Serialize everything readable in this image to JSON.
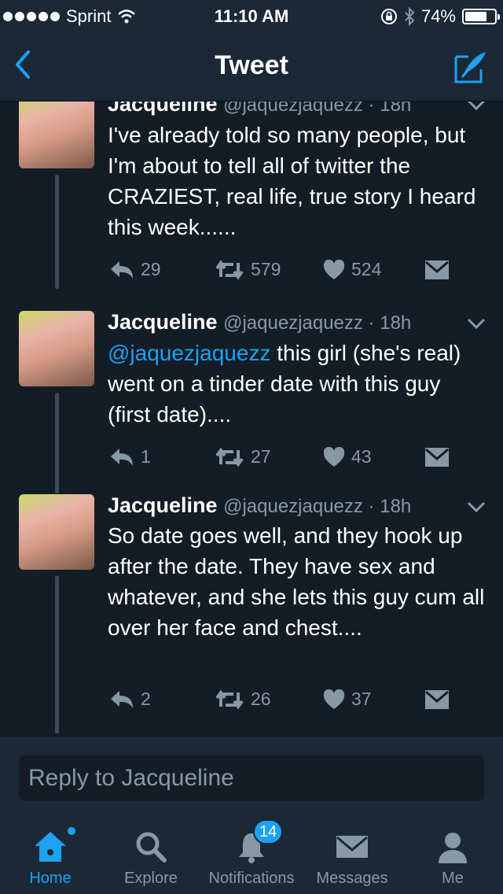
{
  "status": {
    "carrier": "Sprint",
    "time": "11:10 AM",
    "battery": "74%",
    "battery_level": 0.74
  },
  "nav": {
    "title": "Tweet"
  },
  "tweets": [
    {
      "name": "Jacqueline",
      "handle": "@jaquezjaquezz",
      "time": "18h",
      "text": "I've already told so many people, but I'm about to tell all of twitter the CRAZIEST, real life, true story I heard this week......",
      "replies": "29",
      "retweets": "579",
      "likes": "524"
    },
    {
      "name": "Jacqueline",
      "handle": "@jaquezjaquezz",
      "time": "18h",
      "mention": "@jaquezjaquezz",
      "text": "this girl (she's real) went on a tinder date with this guy (first date)....",
      "replies": "1",
      "retweets": "27",
      "likes": "43"
    },
    {
      "name": "Jacqueline",
      "handle": "@jaquezjaquezz",
      "time": "18h",
      "text": "So date goes well, and they hook up after the date. They have sex and whatever, and she lets this guy cum all over her face and chest....",
      "replies": "2",
      "retweets": "26",
      "likes": "37"
    }
  ],
  "reply": {
    "placeholder": "Reply to Jacqueline"
  },
  "tabs": {
    "home": "Home",
    "explore": "Explore",
    "notifications": "Notifications",
    "notifications_badge": "14",
    "messages": "Messages",
    "me": "Me"
  },
  "colors": {
    "background": "#141d26",
    "bar": "#1b2836",
    "accent": "#1da1f2",
    "muted": "#8899a6"
  }
}
